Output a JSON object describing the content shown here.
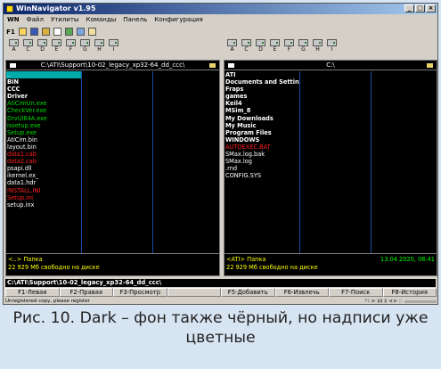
{
  "window": {
    "title": "WinNavigator v1.95",
    "controls": [
      "_",
      "□",
      "×"
    ]
  },
  "menu": [
    "WN",
    "Файл",
    "Утилиты",
    "Команды",
    "Панель",
    "Конфигурация"
  ],
  "toolbar": {
    "f1_label": "F1"
  },
  "drives": [
    "A",
    "C",
    "D",
    "E",
    "F",
    "G",
    "H",
    "I"
  ],
  "left_panel": {
    "path": "C:\\ATI\\Support\\10-02_legacy_xp32-64_dd_ccc\\",
    "files": [
      {
        "name": "..",
        "color": "#ffffff"
      },
      {
        "name": "BIN",
        "color": "#ffffff",
        "bold": true
      },
      {
        "name": "CCC",
        "color": "#ffffff",
        "bold": true
      },
      {
        "name": "Driver",
        "color": "#ffffff",
        "bold": true
      },
      {
        "name": "AtiCimUn.exe",
        "color": "#00dd00"
      },
      {
        "name": "CheckVer.exe",
        "color": "#00dd00"
      },
      {
        "name": "DrvUl64A.exe",
        "color": "#00dd00"
      },
      {
        "name": "issetup.exe",
        "color": "#00dd00"
      },
      {
        "name": "Setup.exe",
        "color": "#00dd00"
      },
      {
        "name": "AtiCim.bin",
        "color": "#ffffff"
      },
      {
        "name": "layout.bin",
        "color": "#ffffff"
      },
      {
        "name": "data1.cab",
        "color": "#ff2020"
      },
      {
        "name": "data2.cab",
        "color": "#ff2020"
      },
      {
        "name": "psapi.dll",
        "color": "#ffffff"
      },
      {
        "name": "ikernel.ex_",
        "color": "#ffffff"
      },
      {
        "name": "data1.hdr",
        "color": "#ffffff"
      },
      {
        "name": "INSTALL.INI",
        "color": "#ff2020"
      },
      {
        "name": "Setup.ini",
        "color": "#ff2020"
      },
      {
        "name": "setup.inx",
        "color": "#ffffff"
      }
    ],
    "footer": {
      "selected": "<..>  Папка",
      "free": "22 929 Мб свободно на диске"
    }
  },
  "right_panel": {
    "path": "C:\\",
    "files": [
      {
        "name": "ATI",
        "color": "#ffffff",
        "bold": true
      },
      {
        "name": "Documents and Settin",
        "color": "#ffffff",
        "bold": true
      },
      {
        "name": "Fraps",
        "color": "#ffffff",
        "bold": true
      },
      {
        "name": "games",
        "color": "#ffffff",
        "bold": true
      },
      {
        "name": "Keil4",
        "color": "#ffffff",
        "bold": true
      },
      {
        "name": "MSim_8",
        "color": "#ffffff",
        "bold": true
      },
      {
        "name": "My Downloads",
        "color": "#ffffff",
        "bold": true
      },
      {
        "name": "My Music",
        "color": "#ffffff",
        "bold": true
      },
      {
        "name": "Program Files",
        "color": "#ffffff",
        "bold": true
      },
      {
        "name": "WINDOWS",
        "color": "#ffffff",
        "bold": true
      },
      {
        "name": "AUTOEXEC.BAT",
        "color": "#ff2020"
      },
      {
        "name": "SMax.log.bak",
        "color": "#ffffff"
      },
      {
        "name": "SMax.log",
        "color": "#ffffff"
      },
      {
        "name": ".rnd",
        "color": "#ffffff"
      },
      {
        "name": "CONFIG.SYS",
        "color": "#ffffff"
      }
    ],
    "footer": {
      "selected": "<ATI>  Папка",
      "date": "13.04.2020, 08:41",
      "free": "22 929 Мб свободно на диске"
    }
  },
  "cmdline": "C:\\ATI\\Support\\10-02_legacy_xp32-64_dd_ccc\\",
  "fkeys": [
    "F1-Левая",
    "F2-Правая",
    "F3-Просмотр",
    "",
    "F5-Добавить",
    "F6-Извлечь",
    "F7-Поиск",
    "F8-История"
  ],
  "status": {
    "text": "Unregistered copy, please register",
    "player": "PL  ▶ ▮▮ ▮ ◀ ▶ ▯"
  },
  "caption": "Рис. 10. Dark – фон также чёрный, но надписи уже цветные"
}
